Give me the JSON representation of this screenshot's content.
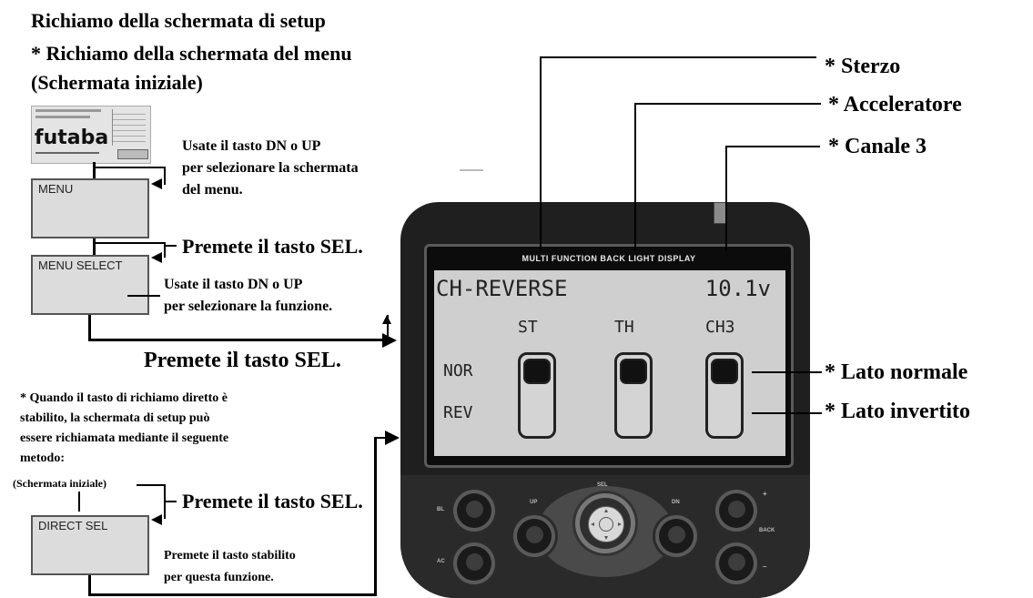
{
  "left": {
    "title_line1": "Richiamo della schermata di setup",
    "title_line2": "* Richiamo della schermata del menu",
    "title_line3": "(Schermata iniziale)",
    "thumb_logo": "futaba",
    "step1_note_line1": "Usate il tasto DN o UP",
    "step1_note_line2": "per selezionare la schermata",
    "step1_note_line3": "del menu.",
    "menu_box": "MENU",
    "step2": "Premete il tasto SEL.",
    "menu_select_box": "MENU SELECT",
    "step3_note_line1": "Usate il tasto DN o UP",
    "step3_note_line2": "per selezionare la funzione.",
    "step4": "Premete il tasto SEL.",
    "direct_note_line1": "* Quando il tasto di richiamo diretto è",
    "direct_note_line2": "stabilito, la schermata di setup può",
    "direct_note_line3": "essere richiamata mediante il seguente",
    "direct_note_line4": "metodo:",
    "initial_screen_label": "(Schermata iniziale)",
    "step5": "Premete il tasto SEL.",
    "direct_sel_box": "DIRECT SEL",
    "step6_line1": "Premete il tasto stabilito",
    "step6_line2": "per questa funzione."
  },
  "callouts": {
    "sterzo": "* Sterzo",
    "acceleratore": "* Acceleratore",
    "canale3": "* Canale 3",
    "lato_normale": "* Lato normale",
    "lato_invertito": "* Lato invertito"
  },
  "lcd": {
    "banner": "MULTI FUNCTION BACK LIGHT DISPLAY",
    "title": "CH-REVERSE",
    "voltage": "10.1v",
    "channels": [
      "ST",
      "TH",
      "CH3"
    ],
    "row_nor": "NOR",
    "row_rev": "REV"
  },
  "keys": {
    "up": "UP",
    "sel": "SEL",
    "dn": "DN",
    "plus": "+",
    "minus": "–",
    "bl": "BL",
    "ac": "AC",
    "back": "BACK"
  },
  "colors": {
    "device_body": "#1f1f1f",
    "lcd_background": "#cfcfcf",
    "screen_box": "#dcdcdc"
  }
}
